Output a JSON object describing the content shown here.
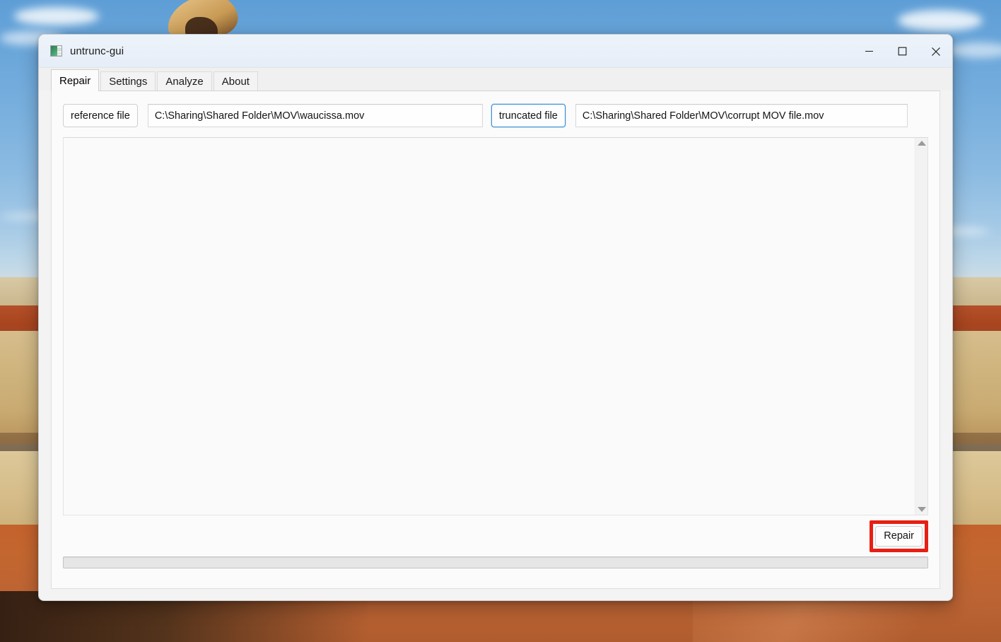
{
  "window": {
    "title": "untrunc-gui",
    "icon": "app-window-icon",
    "controls": {
      "minimize": "minimize-icon",
      "maximize": "maximize-icon",
      "close": "close-icon"
    }
  },
  "tabs": [
    {
      "label": "Repair",
      "active": true
    },
    {
      "label": "Settings",
      "active": false
    },
    {
      "label": "Analyze",
      "active": false
    },
    {
      "label": "About",
      "active": false
    }
  ],
  "repair_tab": {
    "reference": {
      "button_label": "reference file",
      "path_value": "C:\\Sharing\\Shared Folder\\MOV\\waucissa.mov",
      "placeholder": ""
    },
    "truncated": {
      "button_label": "truncated file",
      "path_value": "C:\\Sharing\\Shared Folder\\MOV\\corrupt MOV file.mov",
      "placeholder": "",
      "focused": true
    },
    "log": {
      "content": "",
      "scrollbar": {
        "up_arrow": "scroll-up-arrow-icon",
        "down_arrow": "scroll-down-arrow-icon"
      }
    },
    "repair_button": {
      "label": "Repair",
      "highlighted": true,
      "highlight_color": "#e81f13"
    },
    "progress": {
      "percent": 0,
      "value_text": ""
    }
  },
  "colors": {
    "titlebar": "#e9f0f9",
    "tabstrip": "#f0f0f0",
    "panel": "#fbfbfb",
    "window_body": "#f3f3f3",
    "focus_blue": "#3d8fd6",
    "annotation_red": "#e81f13"
  }
}
